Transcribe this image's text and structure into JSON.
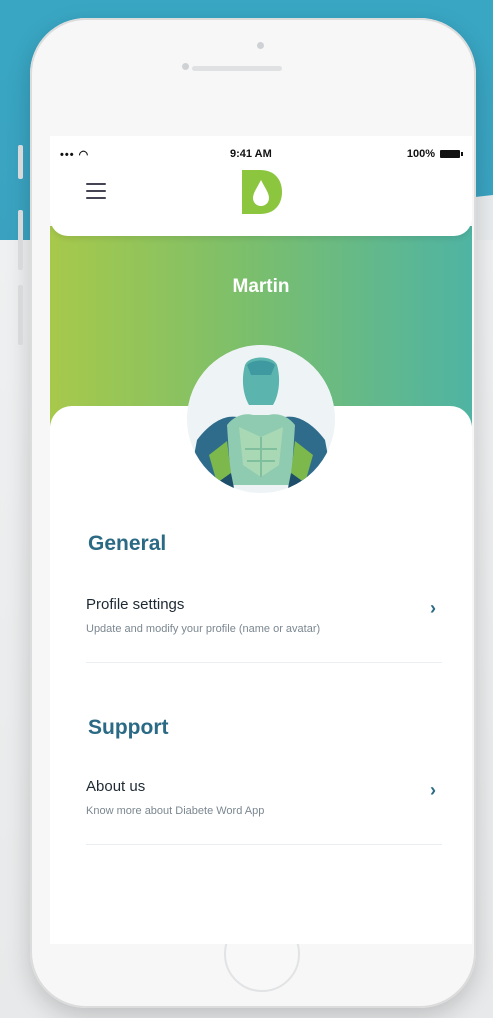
{
  "status_bar": {
    "signal": "••• ◠",
    "time": "9:41 AM",
    "battery": "100%"
  },
  "header": {
    "menu_icon": "hamburger-icon",
    "logo_icon": "diabete-drop-logo"
  },
  "profile": {
    "name": "Martin",
    "avatar_icon": "superhero-avatar"
  },
  "sections": [
    {
      "title": "General",
      "items": [
        {
          "title": "Profile settings",
          "subtitle": "Update and modify your profile (name or avatar)",
          "icon": "chevron-right-icon"
        }
      ]
    },
    {
      "title": "Support",
      "items": [
        {
          "title": "About us",
          "subtitle": "Know more about Diabete Word App",
          "icon": "chevron-right-icon"
        }
      ]
    }
  ],
  "colors": {
    "accent": "#2b6a85",
    "hero_start": "#a7c94b",
    "hero_end": "#4fb4a3",
    "logo_green": "#8cc63f"
  }
}
